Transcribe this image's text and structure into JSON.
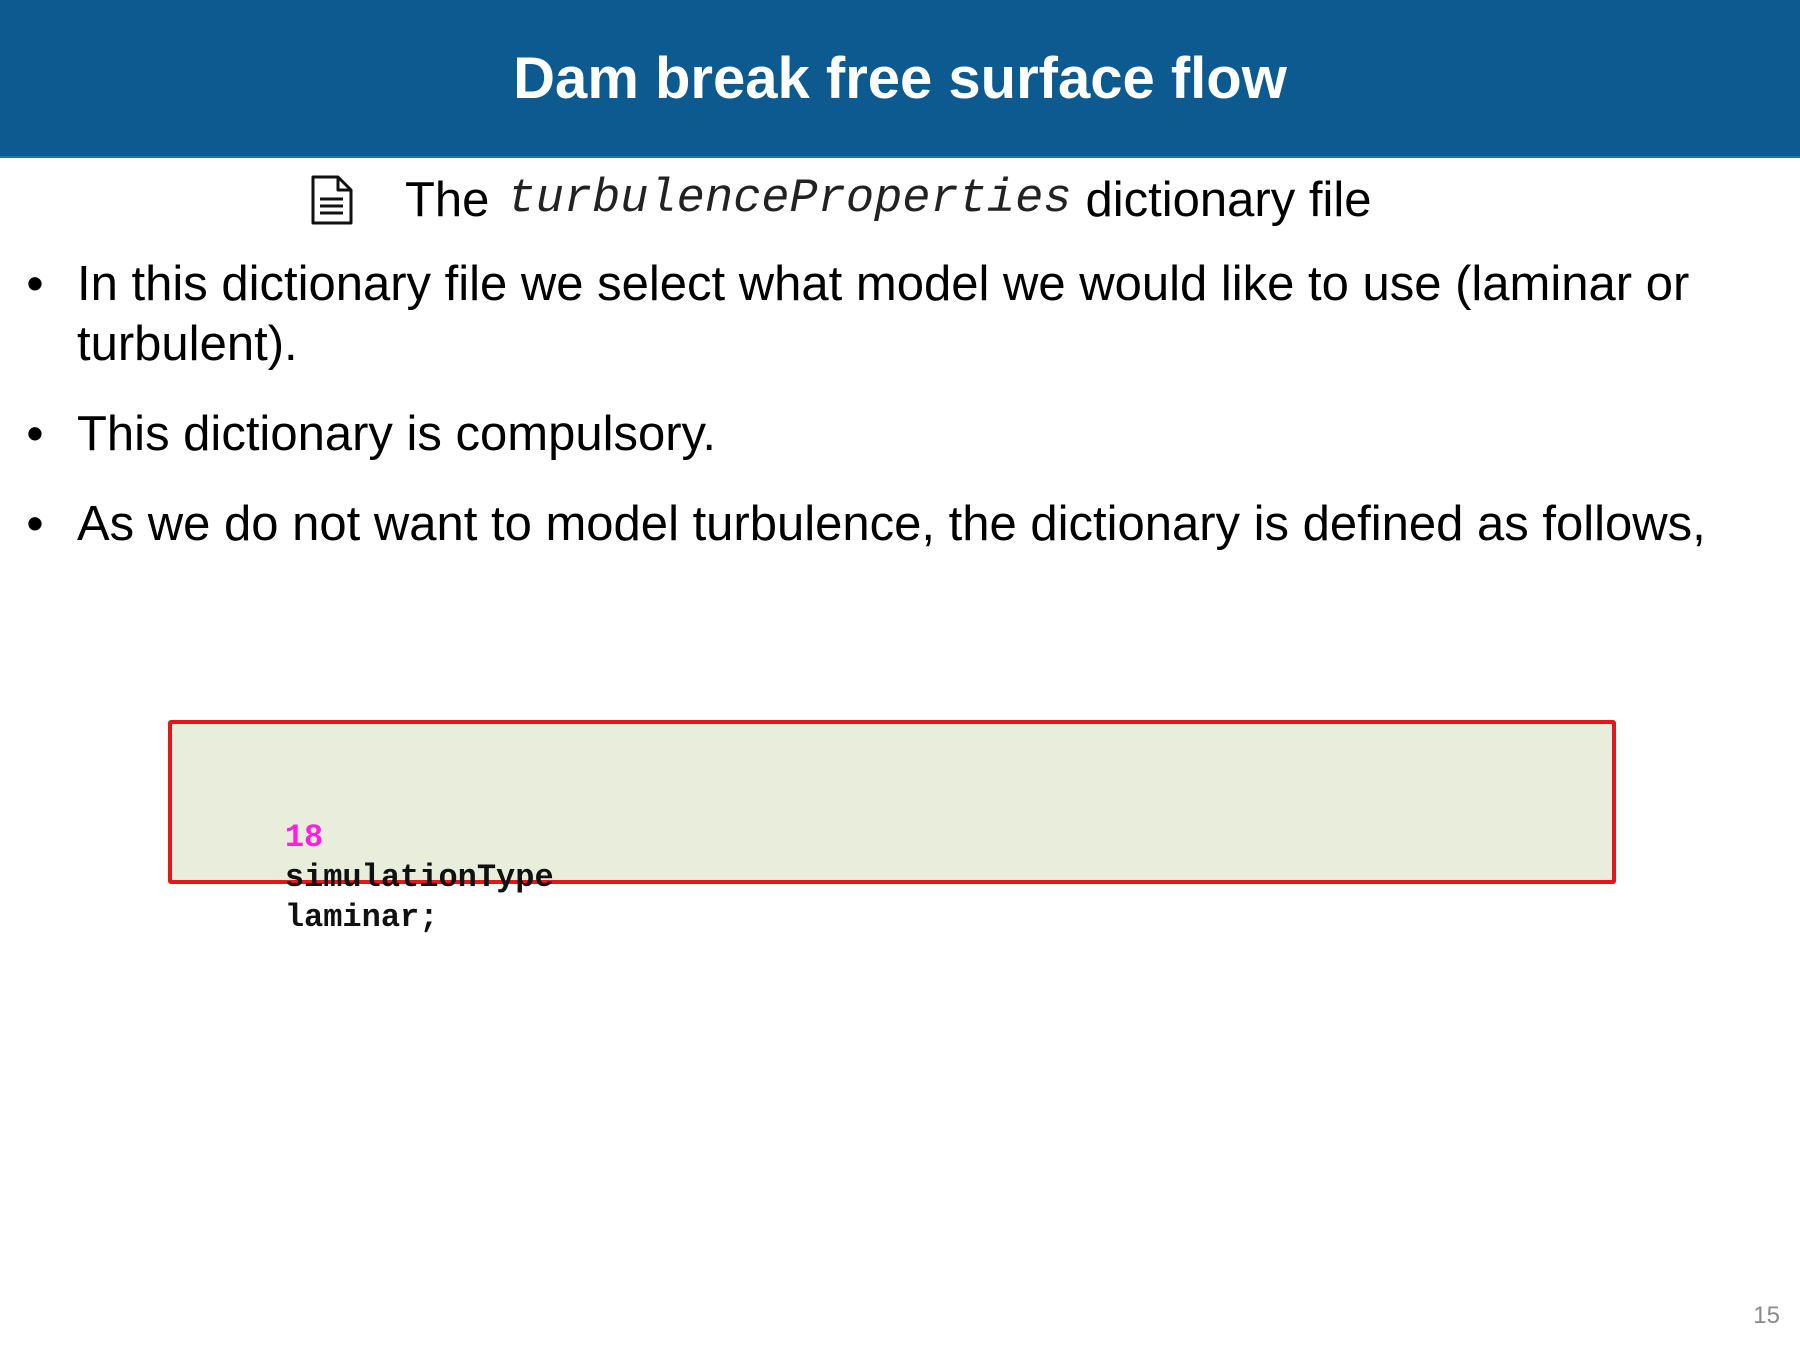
{
  "slide": {
    "title": "Dam break free surface flow",
    "subtitle": {
      "icon": "document-icon",
      "prefix": "The",
      "code_name": "turbulenceProperties",
      "suffix": "dictionary file"
    },
    "bullets": [
      {
        "marker": "•",
        "text": "In this dictionary file we select what model we would like to use (laminar or turbulent)."
      },
      {
        "marker": "•",
        "text": "This dictionary is compulsory."
      },
      {
        "marker": "•",
        "text": "As we do not want to model turbulence, the dictionary is defined as follows,"
      }
    ],
    "code_block": {
      "line_number": "18",
      "keyword": "simulationType",
      "value": "laminar;"
    },
    "page_number": "15"
  },
  "colors": {
    "title_bar": "#0c5a8f",
    "code_background": "#e9eddc",
    "code_border": "#e8141b",
    "line_number": "#ff1fe0",
    "page_number": "#8a8a8a"
  }
}
